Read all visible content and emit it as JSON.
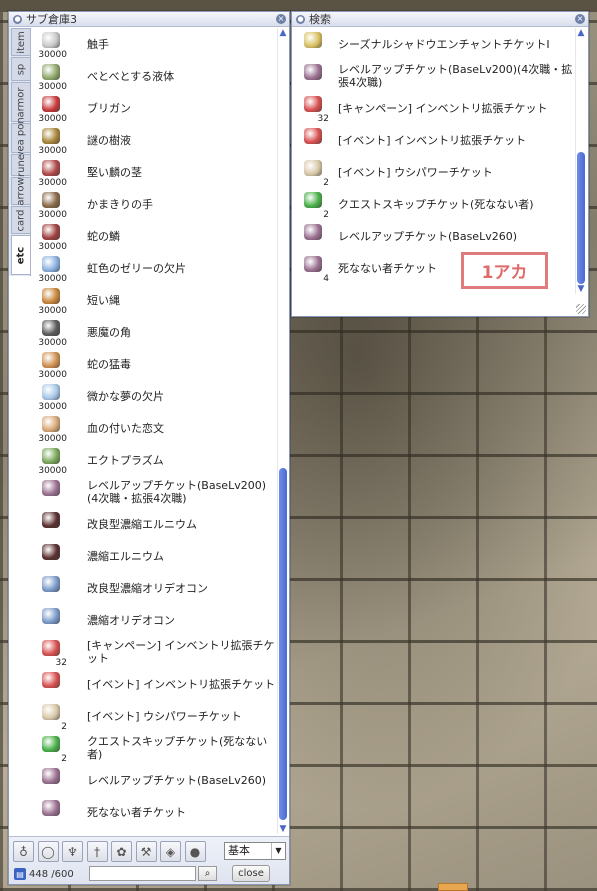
{
  "storage": {
    "title": "サブ倉庫3",
    "tabs": [
      {
        "label": "item",
        "active": false
      },
      {
        "label": "sp",
        "active": false
      },
      {
        "label": "armor",
        "active": false
      },
      {
        "label": "wea pon",
        "active": false
      },
      {
        "label": "rune",
        "active": false
      },
      {
        "label": "arrow",
        "active": false
      },
      {
        "label": "card",
        "active": false
      },
      {
        "label": "etc",
        "active": true
      }
    ],
    "items": [
      {
        "name": "触手",
        "qty": "30000",
        "icon": "tentacle-icon",
        "color": "#c8c8c8"
      },
      {
        "name": "べとべとする液体",
        "qty": "30000",
        "icon": "sticky-liquid-icon",
        "color": "#8fa86a"
      },
      {
        "name": "ブリガン",
        "qty": "30000",
        "icon": "brigan-icon",
        "color": "#c83a3a"
      },
      {
        "name": "謎の樹液",
        "qty": "30000",
        "icon": "sap-icon",
        "color": "#a8863a"
      },
      {
        "name": "堅い麟の茎",
        "qty": "30000",
        "icon": "stem-icon",
        "color": "#b04848"
      },
      {
        "name": "かまきりの手",
        "qty": "30000",
        "icon": "mantis-hand-icon",
        "color": "#8a6a4a"
      },
      {
        "name": "蛇の鱗",
        "qty": "30000",
        "icon": "snake-scale-icon",
        "color": "#a04040"
      },
      {
        "name": "虹色のゼリーの欠片",
        "qty": "30000",
        "icon": "jelly-icon",
        "color": "#8ab0e0"
      },
      {
        "name": "短い縄",
        "qty": "30000",
        "icon": "rope-icon",
        "color": "#c8863a"
      },
      {
        "name": "悪魔の角",
        "qty": "30000",
        "icon": "horn-icon",
        "color": "#5a5a5a"
      },
      {
        "name": "蛇の猛毒",
        "qty": "30000",
        "icon": "venom-icon",
        "color": "#d09050"
      },
      {
        "name": "微かな夢の欠片",
        "qty": "30000",
        "icon": "dream-shard-icon",
        "color": "#a8c8e8"
      },
      {
        "name": "血の付いた恋文",
        "qty": "30000",
        "icon": "love-letter-icon",
        "color": "#d8a878"
      },
      {
        "name": "エクトプラズム",
        "qty": "30000",
        "icon": "ectoplasm-icon",
        "color": "#7aa85a"
      },
      {
        "name": "レベルアップチケット(BaseLv200)(4次職・拡張4次職)",
        "qty": "",
        "icon": "levelup-ticket-icon",
        "color": "#9a7090"
      },
      {
        "name": "改良型濃縮エルニウム",
        "qty": "",
        "icon": "elunium-icon",
        "color": "#5a3030"
      },
      {
        "name": "濃縮エルニウム",
        "qty": "",
        "icon": "elunium-icon",
        "color": "#5a3030"
      },
      {
        "name": "改良型濃縮オリデオコン",
        "qty": "",
        "icon": "oridecon-icon",
        "color": "#7a9ac8"
      },
      {
        "name": "濃縮オリデオコン",
        "qty": "",
        "icon": "oridecon-icon",
        "color": "#7a9ac8"
      },
      {
        "name": "[キャンペーン] インベントリ拡張チケット",
        "qty": "32",
        "icon": "inventory-ticket-icon",
        "color": "#d85050"
      },
      {
        "name": "[イベント] インベントリ拡張チケット",
        "qty": "",
        "icon": "inventory-ticket-icon",
        "color": "#d85050"
      },
      {
        "name": "[イベント] ウシパワーチケット",
        "qty": "2",
        "icon": "cow-power-ticket-icon",
        "color": "#d8c8a8"
      },
      {
        "name": "クエストスキップチケット(死なない者)",
        "qty": "2",
        "icon": "quest-skip-ticket-icon",
        "color": "#48b048"
      },
      {
        "name": "レベルアップチケット(BaseLv260)",
        "qty": "",
        "icon": "levelup-ticket-icon",
        "color": "#9a7090"
      },
      {
        "name": "死なない者チケット",
        "qty": "",
        "icon": "undying-ticket-icon",
        "color": "#9a7090"
      }
    ],
    "filters": [
      "potion-icon",
      "ring-icon",
      "shield-icon",
      "sword-icon",
      "cards-icon",
      "tool-icon",
      "crest-icon",
      "orb-icon"
    ],
    "filter_glyphs": [
      "♁",
      "◯",
      "♆",
      "†",
      "✿",
      "⚒",
      "◈",
      "●"
    ],
    "mode_select": "基本",
    "capacity": "448 /600",
    "close_label": "close",
    "search_placeholder": ""
  },
  "search": {
    "title": "検索",
    "items": [
      {
        "name": "シーズナルシャドウエンチャントチケットI",
        "qty": "",
        "icon": "scroll-icon",
        "color": "#d8c060"
      },
      {
        "name": "レベルアップチケット(BaseLv200)(4次職・拡張4次職)",
        "qty": "",
        "icon": "levelup-ticket-icon",
        "color": "#9a7090"
      },
      {
        "name": "[キャンペーン] インベントリ拡張チケット",
        "qty": "32",
        "icon": "inventory-ticket-icon",
        "color": "#d85050"
      },
      {
        "name": "[イベント] インベントリ拡張チケット",
        "qty": "",
        "icon": "inventory-ticket-icon",
        "color": "#d85050"
      },
      {
        "name": "[イベント] ウシパワーチケット",
        "qty": "2",
        "icon": "cow-power-ticket-icon",
        "color": "#d8c8a8"
      },
      {
        "name": "クエストスキップチケット(死なない者)",
        "qty": "2",
        "icon": "quest-skip-ticket-icon",
        "color": "#48b048"
      },
      {
        "name": "レベルアップチケット(BaseLv260)",
        "qty": "",
        "icon": "levelup-ticket-icon",
        "color": "#9a7090"
      },
      {
        "name": "死なない者チケット",
        "qty": "4",
        "icon": "undying-ticket-icon",
        "color": "#9a7090"
      }
    ]
  },
  "annotation": "1アカ"
}
